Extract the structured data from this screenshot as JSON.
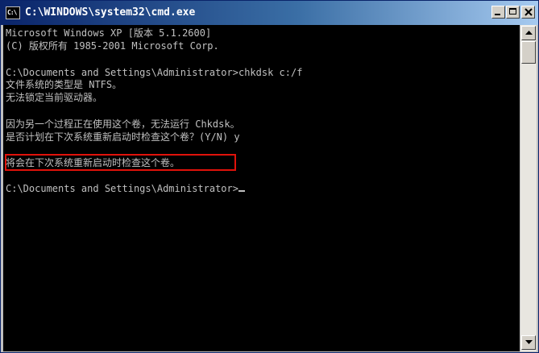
{
  "window": {
    "title": "C:\\WINDOWS\\system32\\cmd.exe",
    "icon": "cmd-icon",
    "icon_label": "C:\\"
  },
  "console": {
    "lines": [
      "Microsoft Windows XP [版本 5.1.2600]",
      "(C) 版权所有 1985-2001 Microsoft Corp.",
      "C:\\Documents and Settings\\Administrator>chkdsk c:/f",
      "文件系统的类型是 NTFS。",
      "无法锁定当前驱动器。",
      "因为另一个过程正在使用这个卷，无法运行 Chkdsk。",
      "是否计划在下次系统重新启动时检查这个卷？(Y/N) y",
      "将会在下次系统重新启动时检查这个卷。",
      "C:\\Documents and Settings\\Administrator>"
    ],
    "text_color": "#c0c0c0",
    "background": "#000000",
    "highlight_color": "#e0120a"
  },
  "titlebar_buttons": {
    "minimize": "minimize-icon",
    "maximize": "maximize-icon",
    "close": "close-icon"
  },
  "scrollbar": {
    "up": "arrow-up-icon",
    "down": "arrow-down-icon"
  }
}
